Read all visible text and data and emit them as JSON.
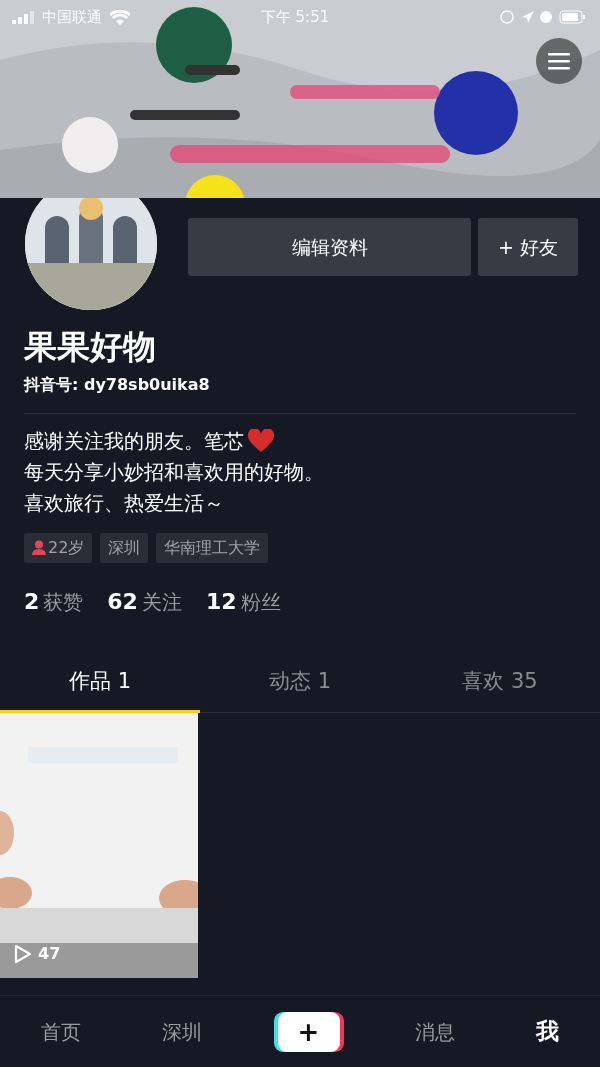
{
  "status_bar": {
    "carrier": "中国联通",
    "time": "下午 5:51"
  },
  "profile": {
    "name": "果果好物",
    "account_id": "抖音号: dy78sb0uika8",
    "buttons": [
      {
        "label": "编辑资料",
        "kind": "edit"
      },
      {
        "label": "+ 好友",
        "kind": "add"
      }
    ]
  },
  "bio": [
    {
      "kind": "heart",
      "text": "感谢关注我的朋友。笔芯"
    },
    {
      "kind": "plain",
      "text": "每天分享小妙招和喜欢用的好物。"
    },
    {
      "kind": "plain",
      "text": "喜欢旅行、热爱生活～"
    }
  ],
  "tags": [
    {
      "kind": "age",
      "text": "22岁"
    },
    {
      "kind": "plain",
      "text": "深圳"
    },
    {
      "kind": "plain",
      "text": "华南理工大学"
    }
  ],
  "stats": [
    {
      "count": "2",
      "label": "获赞"
    },
    {
      "count": "62",
      "label": "关注"
    },
    {
      "count": "12",
      "label": "粉丝"
    }
  ],
  "tabs": [
    {
      "label": "作品 1",
      "selected": true
    },
    {
      "label": "动态 1",
      "selected": false
    },
    {
      "label": "喜欢 35",
      "selected": false
    }
  ],
  "videos": [
    {
      "plays": "47"
    }
  ],
  "bottom_nav": [
    {
      "kind": "text",
      "label": "首页",
      "selected": false
    },
    {
      "kind": "text",
      "label": "深圳",
      "selected": false
    },
    {
      "kind": "create",
      "label": "+",
      "selected": false
    },
    {
      "kind": "text",
      "label": "消息",
      "selected": false
    },
    {
      "kind": "text",
      "label": "我",
      "selected": true
    }
  ]
}
